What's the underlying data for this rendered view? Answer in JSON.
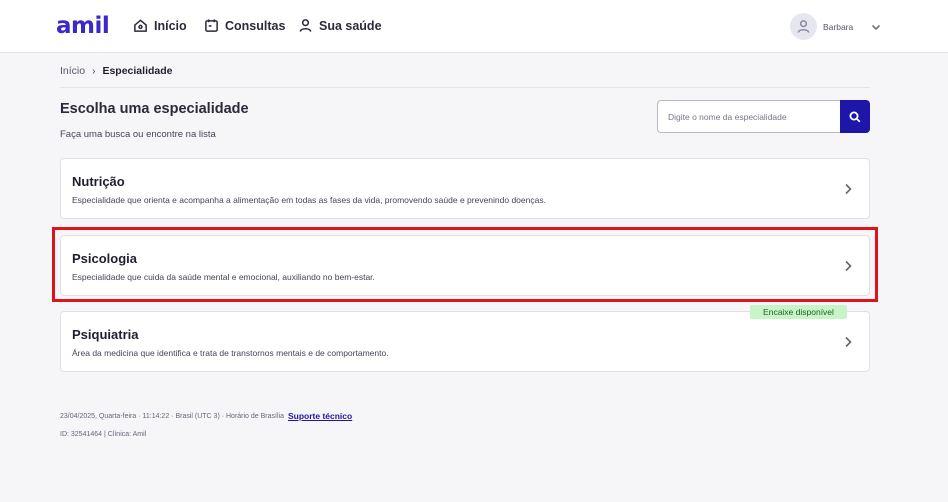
{
  "header": {
    "logo": "amil",
    "nav": [
      {
        "label": "Início",
        "icon": "home-icon"
      },
      {
        "label": "Consultas",
        "icon": "calendar-icon"
      },
      {
        "label": "Sua saúde",
        "icon": "person-icon"
      }
    ],
    "user": {
      "name": "Barbara"
    }
  },
  "breadcrumb": {
    "home": "Início",
    "separator": "›",
    "current": "Especialidade"
  },
  "page": {
    "title": "Escolha uma especialidade",
    "subtitle": "Faça uma busca ou encontre na lista"
  },
  "search": {
    "placeholder": "Digite o nome da especialidade"
  },
  "specialties": [
    {
      "title": "Nutrição",
      "description": "Especialidade que orienta e acompanha a alimentação em todas as fases da vida, promovendo saúde e prevenindo doenças."
    },
    {
      "title": "Psicologia",
      "description": "Especialidade que cuida da saúde mental e emocional, auxiliando no bem-estar."
    },
    {
      "title": "Psiquiatria",
      "description": "Área da medicina que identifica e trata de transtornos mentais e de comportamento.",
      "badge": "Encaixe disponível"
    }
  ],
  "footer": {
    "datetime": "23/04/2025, Quarta-feira · 11:14:22 · Brasil (UTC 3) · Horário de Brasília",
    "support_link": "Suporte técnico",
    "id_line": "ID: 32541464 | Clínica: Amil"
  },
  "colors": {
    "brand": "#3b28cc",
    "search_button": "#1e16a8",
    "highlight": "#e0131b",
    "badge_bg": "#c8f5c8"
  }
}
